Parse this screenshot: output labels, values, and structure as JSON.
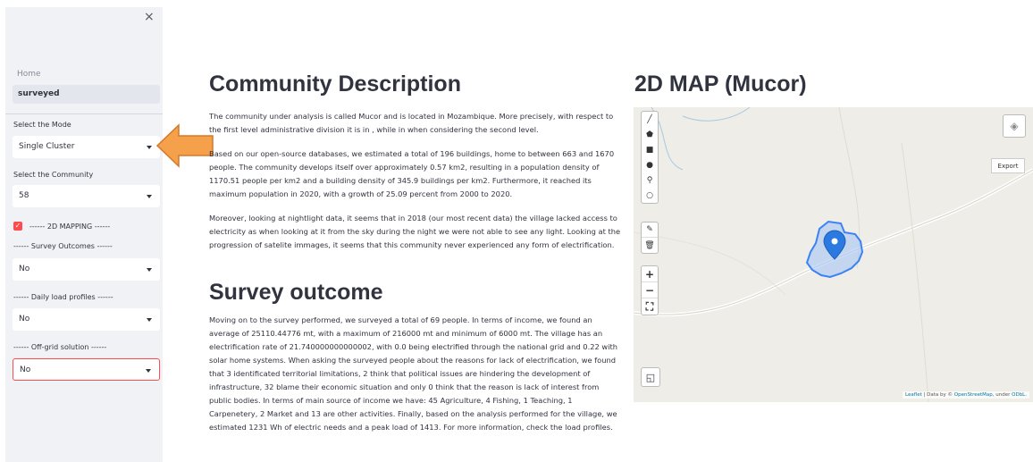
{
  "sidebar": {
    "close": "×",
    "nav_home": "Home",
    "nav_active": "surveyed",
    "mode_label": "Select the Mode",
    "mode_value": "Single Cluster",
    "community_label": "Select the Community",
    "community_value": "58",
    "mapping_label": "------ 2D MAPPING ------",
    "survey_label": "------ Survey Outcomes ------",
    "survey_value": "No",
    "daily_label": "------ Daily load profiles ------",
    "daily_value": "No",
    "offgrid_label": "------ Off-grid solution ------",
    "offgrid_value": "No"
  },
  "main": {
    "community_title": "Community Description",
    "p1": "The community under analysis is called Mucor and is located in Mozambique. More precisely, with respect to the first level administrative division it is in , while in when considering the second level.",
    "p2": "Based on our open-source databases, we estimated a total of 196 buildings, home to between 663 and 1670 people. The community develops itself over approximately 0.57 km2, resulting in a population density of 1170.51 people per km2 and a building density of 345.9 buildings per km2. Furthermore, it reached its maximum population in 2020, with a growth of 25.09 percent from 2000 to 2020.",
    "p3": "Moreover, looking at nightlight data, it seems that in 2018 (our most recent data) the village lacked access to electricity as when looking at it from the sky during the night we were not able to see any light. Looking at the progression of satelite immages, it seems that this community never experienced any form of electrification.",
    "survey_title": "Survey outcome",
    "p4": "Moving on to the survey performed, we surveyed a total of 69 people. In terms of income, we found an average of 25110.44776 mt, with a maximum of 216000 mt and minimum of 6000 mt. The village has an electrification rate of 21.740000000000002, with 0.0 being electrified through the national grid and 0.22 with solar home systems. When asking the surveyed people about the reasons for lack of electrification, we found that 3 identificated territorial limitations, 2 think that political issues are hindering the development of infrastructure, 32 blame their economic situation and only 0 think that the reason is lack of interest from public bodies. In terms of main source of income we have: 45 Agriculture, 4 Fishing, 1 Teaching, 1 Carpenetery, 2 Market and 13 are other activities. Finally, based on the analysis performed for the village, we estimated 1231 Wh of electric needs and a peak load of 1413. For more information, check the load profiles."
  },
  "map": {
    "title": "2D MAP (Mucor)",
    "export": "Export",
    "attribution_leaflet": "Leaflet",
    "attribution_text": " | Data by © ",
    "attribution_osm": "OpenStreetMap",
    "attribution_under": ", under ",
    "attribution_odbl": "ODbL."
  },
  "colors": {
    "accent": "#ff4b4b",
    "sidebar_bg": "#f0f2f6",
    "arrow_fill": "#f5a04a",
    "polygon": "#3b82f6"
  }
}
